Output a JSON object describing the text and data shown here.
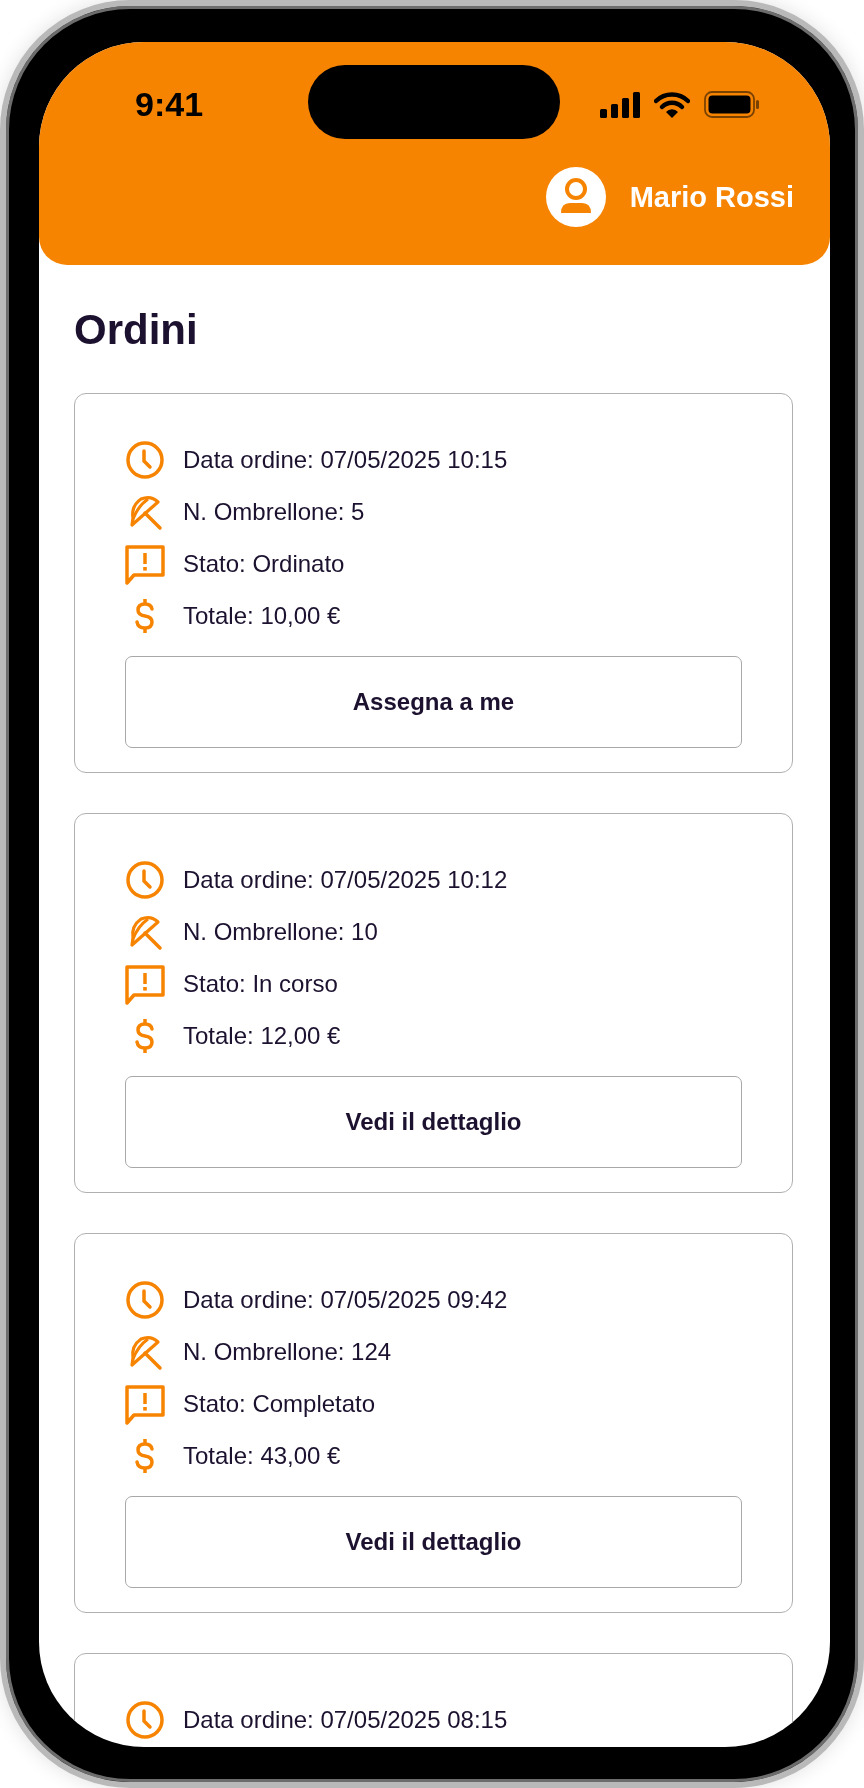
{
  "status_bar": {
    "time": "9:41"
  },
  "header": {
    "user_name": "Mario Rossi"
  },
  "page_title": "Ordini",
  "orders": [
    {
      "rows": [
        {
          "kind": "date",
          "text": "Data ordine: 07/05/2025 10:15"
        },
        {
          "kind": "umbrella",
          "text": "N. Ombrellone: 5"
        },
        {
          "kind": "status",
          "text": "Stato: Ordinato"
        },
        {
          "kind": "total",
          "text": "Totale: 10,00 €"
        }
      ],
      "button": "Assegna a me"
    },
    {
      "rows": [
        {
          "kind": "date",
          "text": "Data ordine: 07/05/2025 10:12"
        },
        {
          "kind": "umbrella",
          "text": "N. Ombrellone: 10"
        },
        {
          "kind": "status",
          "text": "Stato: In corso"
        },
        {
          "kind": "total",
          "text": "Totale: 12,00 €"
        }
      ],
      "button": "Vedi il dettaglio"
    },
    {
      "rows": [
        {
          "kind": "date",
          "text": "Data ordine: 07/05/2025 09:42"
        },
        {
          "kind": "umbrella",
          "text": "N. Ombrellone: 124"
        },
        {
          "kind": "status",
          "text": "Stato: Completato"
        },
        {
          "kind": "total",
          "text": "Totale: 43,00 €"
        }
      ],
      "button": "Vedi il dettaglio"
    },
    {
      "rows": [
        {
          "kind": "date",
          "text": "Data ordine: 07/05/2025 08:15"
        }
      ]
    }
  ]
}
